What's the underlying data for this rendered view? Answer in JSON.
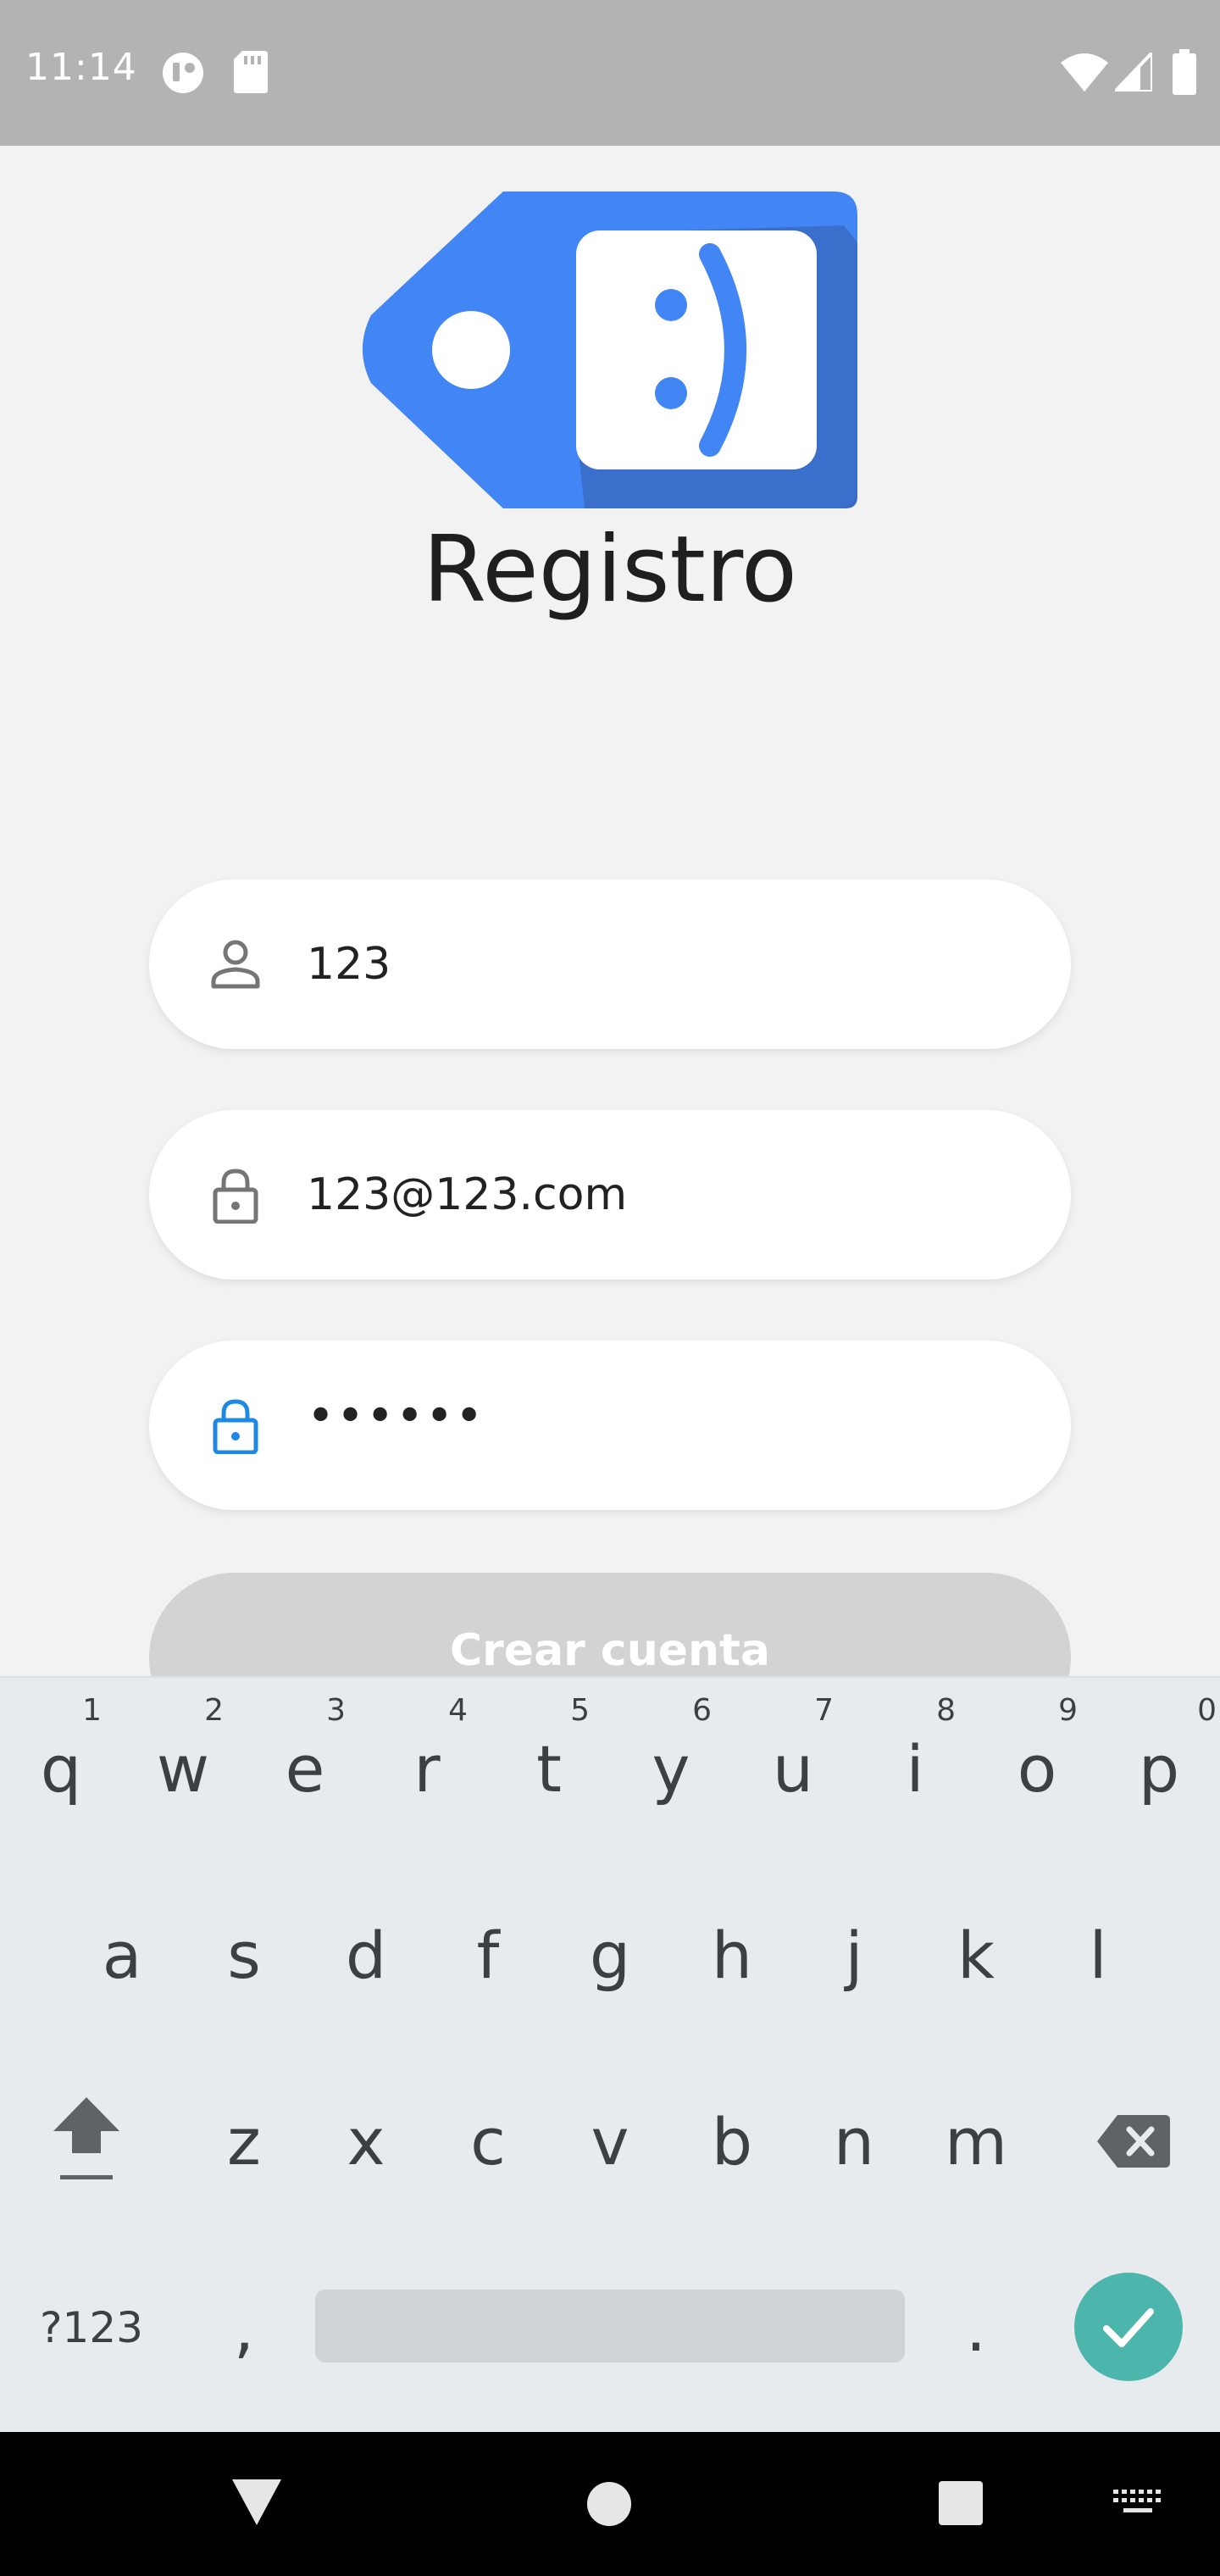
{
  "status_bar": {
    "time": "11:14",
    "left_icons": [
      "data-saver-icon",
      "sd-card-icon"
    ],
    "right_icons": [
      "wifi-icon",
      "signal-icon",
      "battery-icon"
    ]
  },
  "logo": {
    "icon": "smiley-tag-logo",
    "glyph": ":)",
    "colors": {
      "tag": "#4285f4",
      "shadow": "#3a6bc4"
    }
  },
  "title": "Registro",
  "form": {
    "username": {
      "icon": "person-icon",
      "value": "123"
    },
    "email": {
      "icon": "lock-icon",
      "value": "123@123.com"
    },
    "password": {
      "icon": "lock-icon",
      "value": "••••••",
      "focused": true,
      "focus_color": "#1e88e5"
    },
    "submit": {
      "label": "Crear cuenta",
      "enabled": false,
      "color": "#d3d3d3"
    }
  },
  "keyboard": {
    "row1": [
      {
        "letter": "q",
        "num": "1"
      },
      {
        "letter": "w",
        "num": "2"
      },
      {
        "letter": "e",
        "num": "3"
      },
      {
        "letter": "r",
        "num": "4"
      },
      {
        "letter": "t",
        "num": "5"
      },
      {
        "letter": "y",
        "num": "6"
      },
      {
        "letter": "u",
        "num": "7"
      },
      {
        "letter": "i",
        "num": "8"
      },
      {
        "letter": "o",
        "num": "9"
      },
      {
        "letter": "p",
        "num": "0"
      }
    ],
    "row2": [
      "a",
      "s",
      "d",
      "f",
      "g",
      "h",
      "j",
      "k",
      "l"
    ],
    "row3": [
      "z",
      "x",
      "c",
      "v",
      "b",
      "n",
      "m"
    ],
    "symbols_label": "?123",
    "comma": ",",
    "period": ".",
    "special_icons": [
      "shift-icon",
      "backspace-icon",
      "enter-check-icon"
    ],
    "enter_color": "#4db6ac"
  },
  "nav_bar": {
    "icons": [
      "back-icon",
      "home-icon",
      "recents-icon",
      "keyboard-switch-icon"
    ]
  }
}
